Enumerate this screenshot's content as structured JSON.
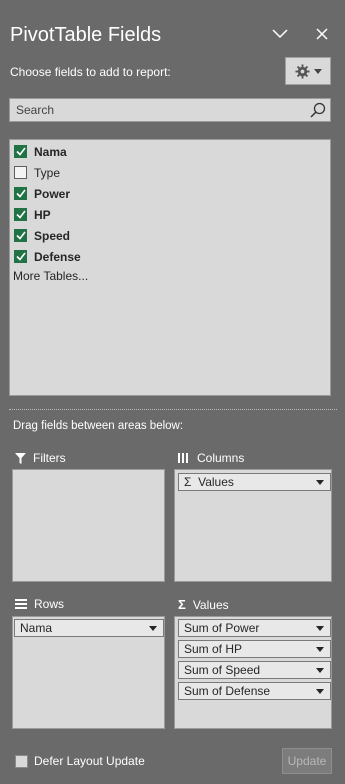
{
  "header": {
    "title": "PivotTable Fields",
    "subtitle": "Choose fields to add to report:"
  },
  "search": {
    "placeholder": "Search"
  },
  "fields": [
    {
      "label": "Nama",
      "checked": true
    },
    {
      "label": "Type",
      "checked": false
    },
    {
      "label": "Power",
      "checked": true
    },
    {
      "label": "HP",
      "checked": true
    },
    {
      "label": "Speed",
      "checked": true
    },
    {
      "label": "Defense",
      "checked": true
    }
  ],
  "more_tables": "More Tables...",
  "drag_hint": "Drag fields between areas below:",
  "areas": {
    "filters": {
      "label": "Filters",
      "items": []
    },
    "columns": {
      "label": "Columns",
      "items": [
        "Values"
      ]
    },
    "rows": {
      "label": "Rows",
      "items": [
        "Nama"
      ]
    },
    "values": {
      "label": "Values",
      "items": [
        "Sum of Power",
        "Sum of HP",
        "Sum of Speed",
        "Sum of Defense"
      ]
    }
  },
  "footer": {
    "defer_label": "Defer Layout Update",
    "update_label": "Update"
  },
  "colors": {
    "panel_bg": "#6a6a6a",
    "checkbox_checked": "#217346"
  },
  "icons": {
    "collapse": "chevron-down-icon",
    "close": "close-icon",
    "settings": "gear-icon",
    "search": "search-icon",
    "filters": "funnel-icon",
    "columns": "columns-icon",
    "rows": "rows-icon",
    "values": "sigma-icon"
  }
}
